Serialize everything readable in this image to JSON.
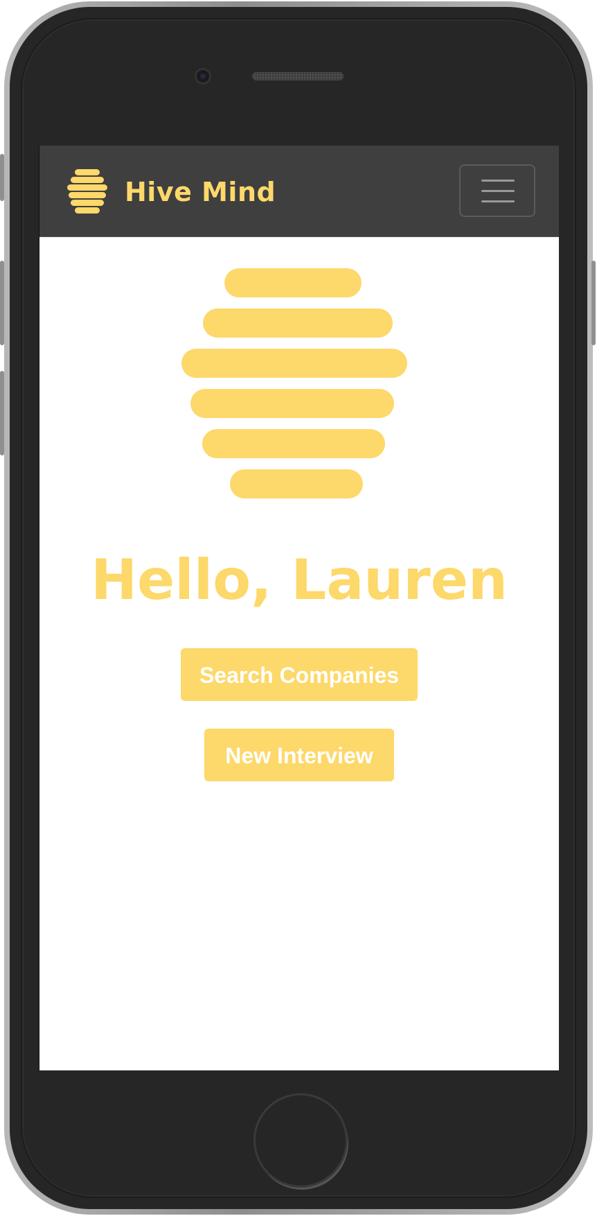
{
  "app": {
    "brand_name": "Hive Mind",
    "accent_color": "#fdd86a",
    "navbar_color": "#3f3f3f"
  },
  "navbar": {
    "logo_icon": "beehive-icon",
    "menu_icon": "hamburger-menu-icon"
  },
  "main": {
    "hero_icon": "beehive-icon",
    "greeting": "Hello, Lauren",
    "buttons": [
      {
        "label": "Search Companies"
      },
      {
        "label": "New Interview"
      }
    ]
  }
}
